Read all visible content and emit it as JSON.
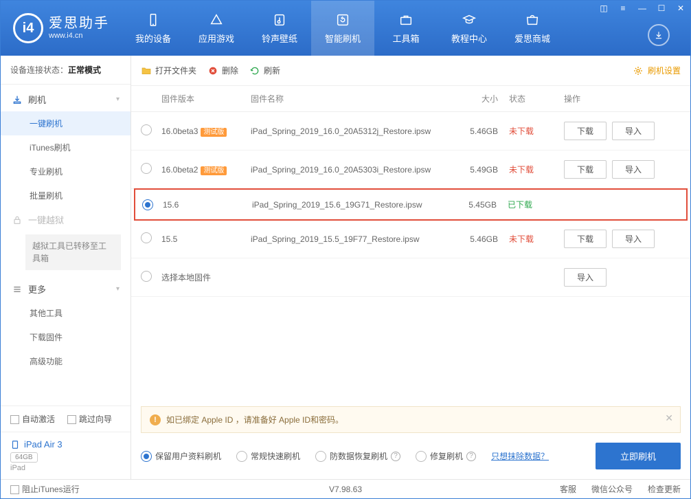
{
  "logo": {
    "cn": "爱思助手",
    "en": "www.i4.cn",
    "badge": "i4"
  },
  "nav": [
    {
      "id": "my-device",
      "label": "我的设备"
    },
    {
      "id": "apps-games",
      "label": "应用游戏"
    },
    {
      "id": "ringtone",
      "label": "铃声壁纸"
    },
    {
      "id": "flash",
      "label": "智能刷机",
      "active": true
    },
    {
      "id": "toolbox",
      "label": "工具箱"
    },
    {
      "id": "tutorial",
      "label": "教程中心"
    },
    {
      "id": "store",
      "label": "爱思商城"
    }
  ],
  "status": {
    "label": "设备连接状态：",
    "value": "正常模式"
  },
  "sidebar": {
    "flash_group": "刷机",
    "items": [
      "一键刷机",
      "iTunes刷机",
      "专业刷机",
      "批量刷机"
    ],
    "jailbreak": "一键越狱",
    "jailbreak_note": "越狱工具已转移至工具箱",
    "more_group": "更多",
    "more_items": [
      "其他工具",
      "下载固件",
      "高级功能"
    ]
  },
  "side_bottom": {
    "auto_activate": "自动激活",
    "skip_guide": "跳过向导"
  },
  "device": {
    "name": "iPad Air 3",
    "capacity": "64GB",
    "sub": "iPad"
  },
  "toolbar": {
    "open_folder": "打开文件夹",
    "delete": "删除",
    "refresh": "刷新",
    "settings": "刷机设置"
  },
  "columns": {
    "version": "固件版本",
    "name": "固件名称",
    "size": "大小",
    "status": "状态",
    "ops": "操作"
  },
  "badge_beta": "测试版",
  "btn_download": "下载",
  "btn_import": "导入",
  "rows": [
    {
      "version": "16.0beta3",
      "beta": true,
      "name": "iPad_Spring_2019_16.0_20A5312j_Restore.ipsw",
      "size": "5.46GB",
      "status": "未下载",
      "status_cls": "not",
      "selected": false,
      "ops": true
    },
    {
      "version": "16.0beta2",
      "beta": true,
      "name": "iPad_Spring_2019_16.0_20A5303i_Restore.ipsw",
      "size": "5.49GB",
      "status": "未下载",
      "status_cls": "not",
      "selected": false,
      "ops": true
    },
    {
      "version": "15.6",
      "beta": false,
      "name": "iPad_Spring_2019_15.6_19G71_Restore.ipsw",
      "size": "5.45GB",
      "status": "已下载",
      "status_cls": "done",
      "selected": true,
      "ops": false,
      "highlight": true
    },
    {
      "version": "15.5",
      "beta": false,
      "name": "iPad_Spring_2019_15.5_19F77_Restore.ipsw",
      "size": "5.46GB",
      "status": "未下载",
      "status_cls": "not",
      "selected": false,
      "ops": true
    }
  ],
  "local_row": "选择本地固件",
  "notice": "如已绑定 Apple ID ，请准备好 Apple ID和密码。",
  "options": {
    "keep_data": "保留用户资料刷机",
    "normal": "常规快速刷机",
    "anti_data": "防数据恢复刷机",
    "repair": "修复刷机",
    "erase_link": "只想抹除数据？"
  },
  "primary": "立即刷机",
  "footer": {
    "block_itunes": "阻止iTunes运行",
    "version": "V7.98.63",
    "links": [
      "客服",
      "微信公众号",
      "检查更新"
    ]
  }
}
